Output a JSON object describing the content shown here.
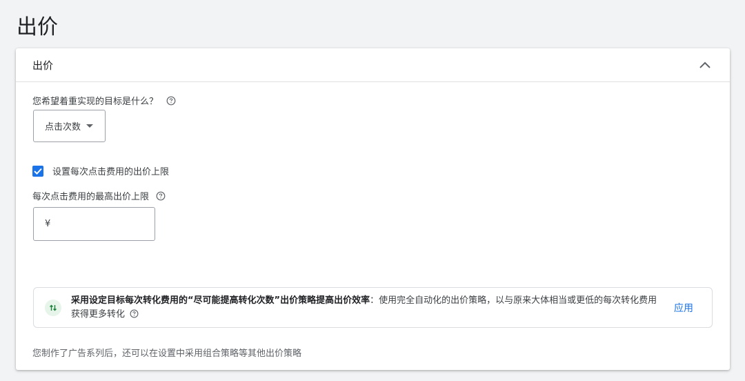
{
  "page": {
    "title": "出价"
  },
  "card": {
    "title": "出价",
    "question_label": "您希望着重实现的目标是什么？",
    "goal_dropdown": {
      "selected": "点击次数"
    },
    "cpc_limit_checkbox": {
      "label": "设置每次点击费用的出价上限",
      "checked": true
    },
    "max_cpc_label": "每次点击费用的最高出价上限",
    "max_cpc_input": {
      "currency": "¥",
      "value": ""
    },
    "recommendation": {
      "bold_text": "采用设定目标每次转化费用的“尽可能提高转化次数”出价策略提高出价效率",
      "text": "：使用完全自动化的出价策略，以与原来大体相当或更低的每次转化费用获得更多转化",
      "apply_label": "应用"
    },
    "footnote": "您制作了广告系列后，还可以在设置中采用组合策略等其他出价策略"
  },
  "colors": {
    "accent": "#1a73e8",
    "rec_icon_bg": "#e6f4ea",
    "rec_icon_fg": "#188038"
  }
}
